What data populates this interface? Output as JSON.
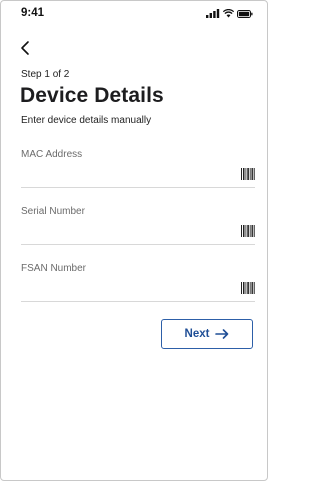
{
  "status_bar": {
    "time": "9:41",
    "icons": [
      "signal-icon",
      "wifi-icon",
      "battery-icon"
    ]
  },
  "navigation": {
    "back_icon": "chevron-left-icon"
  },
  "header": {
    "step": "Step 1 of 2",
    "title": "Device Details",
    "subtitle": "Enter device details manually"
  },
  "form": {
    "fields": [
      {
        "label": "MAC Address",
        "value": "",
        "icon": "barcode-icon"
      },
      {
        "label": "Serial Number",
        "value": "",
        "icon": "barcode-icon"
      },
      {
        "label": "FSAN Number",
        "value": "",
        "icon": "barcode-icon"
      }
    ]
  },
  "actions": {
    "next_label": "Next",
    "next_icon": "arrow-right-icon"
  },
  "colors": {
    "accent": "#1f4e96",
    "border": "#2d5fa8",
    "divider": "#d8d8d8",
    "label": "#6b6b6b"
  }
}
